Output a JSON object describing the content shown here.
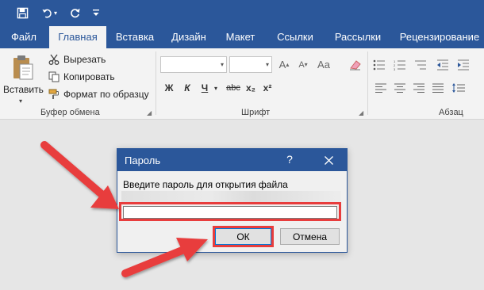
{
  "qat": {
    "icons": [
      "save-icon",
      "undo-icon",
      "dropdown-icon",
      "redo-icon",
      "customize-icon"
    ]
  },
  "tabs": [
    {
      "label": "Файл"
    },
    {
      "label": "Главная"
    },
    {
      "label": "Вставка"
    },
    {
      "label": "Дизайн"
    },
    {
      "label": "Макет"
    },
    {
      "label": "Ссылки"
    },
    {
      "label": "Рассылки"
    },
    {
      "label": "Рецензирование"
    }
  ],
  "ribbon": {
    "clipboard": {
      "paste_label": "Вставить",
      "cut_label": "Вырезать",
      "copy_label": "Копировать",
      "format_painter_label": "Формат по образцу",
      "group_label": "Буфер обмена"
    },
    "font": {
      "font_name_value": "",
      "font_size_value": "",
      "group_label": "Шрифт",
      "buttons": [
        "Ж",
        "К",
        "Ч",
        "abc",
        "x₂",
        "x²"
      ]
    },
    "paragraph": {
      "group_label": "Абзац"
    }
  },
  "dialog": {
    "title": "Пароль",
    "help": "?",
    "prompt": "Введите пароль для открытия файла",
    "password_value": "",
    "ok_label": "ОК",
    "cancel_label": "Отмена"
  },
  "colors": {
    "accent": "#2b579a",
    "highlight": "#e83d3d"
  }
}
